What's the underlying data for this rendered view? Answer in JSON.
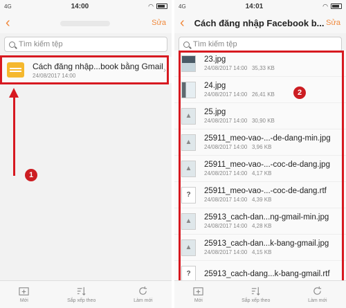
{
  "left": {
    "status": {
      "signal": "4G",
      "time": "14:00"
    },
    "titlebar": {
      "back": "‹",
      "edit": "Sửa"
    },
    "search": {
      "placeholder": "Tìm kiếm tệp"
    },
    "folder": {
      "name": "Cách đăng nhập...book bằng Gmail",
      "date": "24/08/2017 14:00",
      "icon": "folder-icon"
    },
    "badge": "1",
    "bottom": {
      "new": "Mới",
      "sort": "Sắp xếp theo",
      "refresh": "Làm mới"
    }
  },
  "right": {
    "status": {
      "signal": "4G",
      "time": "14:01"
    },
    "titlebar": {
      "back": "‹",
      "title": "Cách đăng nhập Facebook b...",
      "edit": "Sửa"
    },
    "search": {
      "placeholder": "Tìm kiếm tệp"
    },
    "badge": "2",
    "files": [
      {
        "name": "23.jpg",
        "date": "24/08/2017 14:00",
        "size": "35,33 KB",
        "thumb": "photo"
      },
      {
        "name": "24.jpg",
        "date": "24/08/2017 14:00",
        "size": "26,41 KB",
        "thumb": "photo2"
      },
      {
        "name": "25.jpg",
        "date": "24/08/2017 14:00",
        "size": "30,90 KB",
        "thumb": "img"
      },
      {
        "name": "25911_meo-vao-...-de-dang-min.jpg",
        "date": "24/08/2017 14:00",
        "size": "3,96 KB",
        "thumb": "img"
      },
      {
        "name": "25911_meo-vao-...-coc-de-dang.jpg",
        "date": "24/08/2017 14:00",
        "size": "4,17 KB",
        "thumb": "img"
      },
      {
        "name": "25911_meo-vao-...-coc-de-dang.rtf",
        "date": "24/08/2017 14:00",
        "size": "4,39 KB",
        "thumb": "q"
      },
      {
        "name": "25913_cach-dan...ng-gmail-min.jpg",
        "date": "24/08/2017 14:00",
        "size": "4,28 KB",
        "thumb": "img"
      },
      {
        "name": "25913_cach-dan...k-bang-gmail.jpg",
        "date": "24/08/2017 14:00",
        "size": "4,15 KB",
        "thumb": "img"
      },
      {
        "name": "25913_cach-dang...k-bang-gmail.rtf",
        "date": "",
        "size": "",
        "thumb": "q"
      }
    ],
    "bottom": {
      "new": "Mới",
      "sort": "Sắp xếp theo",
      "refresh": "Làm mới"
    }
  },
  "colors": {
    "accent": "#f0883b",
    "highlight": "#d71920",
    "folder": "#f5b82e"
  }
}
